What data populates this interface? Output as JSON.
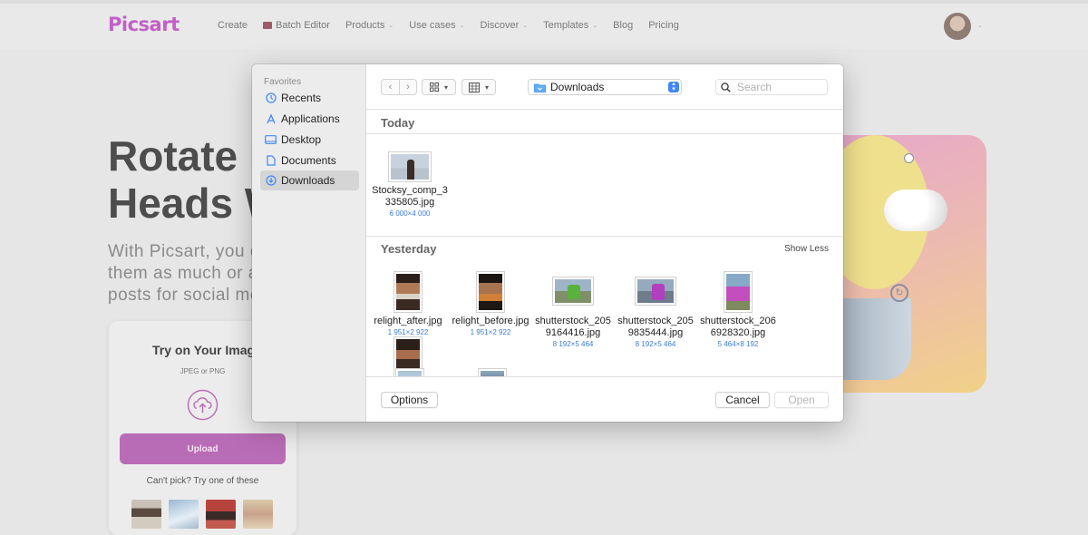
{
  "site": {
    "logo": "Picsart",
    "nav": [
      {
        "label": "Create",
        "chevron": false
      },
      {
        "label": "Batch Editor",
        "chevron": false
      },
      {
        "label": "Products",
        "chevron": true
      },
      {
        "label": "Use cases",
        "chevron": true
      },
      {
        "label": "Discover",
        "chevron": true
      },
      {
        "label": "Templates",
        "chevron": true
      },
      {
        "label": "Blog",
        "chevron": false
      },
      {
        "label": "Pricing",
        "chevron": false
      }
    ],
    "hero_title_1": "Rotate In",
    "hero_title_2": "Heads W",
    "hero_text_1": "With Picsart, you c",
    "hero_text_2": "them as much or a",
    "hero_text_3": "posts for social med",
    "card": {
      "title": "Try on Your Image",
      "subtitle": "JPEG or PNG",
      "upload_label": "Upload",
      "try_text": "Can't pick? Try one of these"
    },
    "brand_color": "#c35fc9"
  },
  "dialog": {
    "sidebar": {
      "heading": "Favorites",
      "items": [
        {
          "label": "Recents",
          "icon": "clock-icon"
        },
        {
          "label": "Applications",
          "icon": "applications-icon"
        },
        {
          "label": "Desktop",
          "icon": "desktop-icon"
        },
        {
          "label": "Documents",
          "icon": "document-icon"
        },
        {
          "label": "Downloads",
          "icon": "download-icon",
          "selected": true
        }
      ]
    },
    "location": "Downloads",
    "search_placeholder": "Search",
    "groups": {
      "today": "Today",
      "yesterday": "Yesterday",
      "show_less": "Show Less"
    },
    "files_today": [
      {
        "name": "Stocksy_comp_3335805.jpg",
        "name_l1": "Stocksy_comp_3",
        "name_l2": "335805.jpg",
        "dims": "6 000×4 000"
      }
    ],
    "files_yesterday": [
      {
        "name_l1": "relight_after.jpg",
        "name_l2": "",
        "dims": "1 951×2 922"
      },
      {
        "name_l1": "relight_before.jpg",
        "name_l2": "",
        "dims": "1 951×2 922"
      },
      {
        "name_l1": "shutterstock_205",
        "name_l2": "9164416.jpg",
        "dims": "8 192×5 464"
      },
      {
        "name_l1": "shutterstock_205",
        "name_l2": "9835444.jpg",
        "dims": "8 192×5 464"
      },
      {
        "name_l1": "shutterstock_206",
        "name_l2": "6928320.jpg",
        "dims": "5 464×8 192"
      }
    ],
    "options_label": "Options",
    "cancel_label": "Cancel",
    "open_label": "Open",
    "accent_color": "#3f88f5"
  }
}
